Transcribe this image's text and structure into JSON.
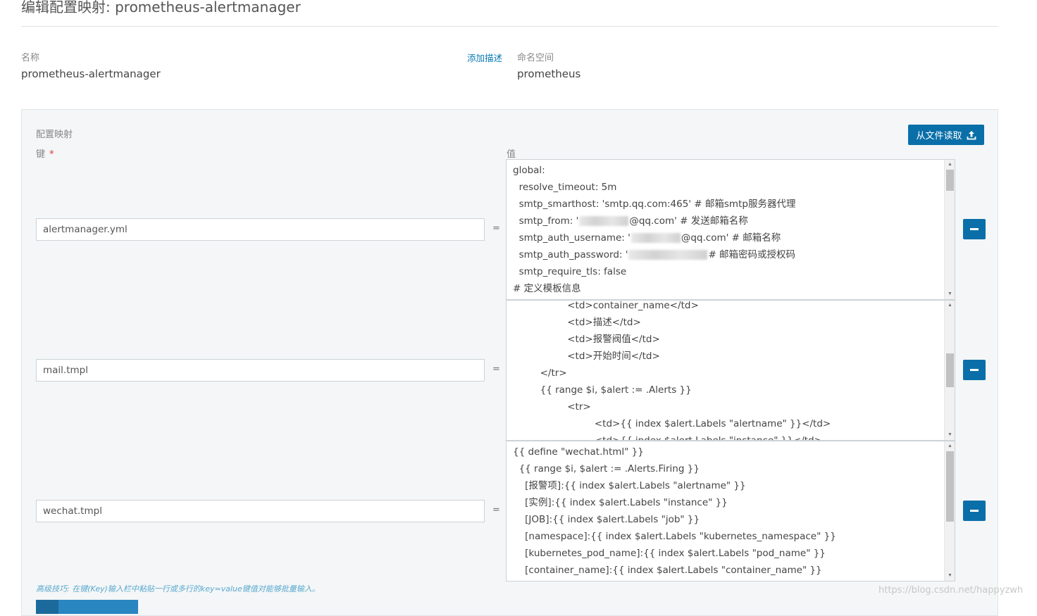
{
  "page": {
    "title": "编辑配置映射: prometheus-alertmanager"
  },
  "meta": {
    "name_label": "名称",
    "name_value": "prometheus-alertmanager",
    "add_description": "添加描述",
    "namespace_label": "命名空间",
    "namespace_value": "prometheus"
  },
  "config": {
    "section_title": "配置映射",
    "key_label": "键",
    "required_mark": "*",
    "value_label": "值",
    "upload_button": "从文件读取",
    "equals": "=",
    "entries": [
      {
        "key": "alertmanager.yml",
        "lines": [
          "global:",
          "  resolve_timeout: 5m",
          "  smtp_smarthost: 'smtp.qq.com:465' # 邮箱smtp服务器代理",
          [
            "  smtp_from: '",
            "@qq.com' # 发送邮箱名称"
          ],
          [
            "  smtp_auth_username: '",
            "@qq.com' # 邮箱名称"
          ],
          [
            "  smtp_auth_password: '",
            "# 邮箱密码或授权码"
          ],
          "  smtp_require_tls: false",
          "# 定义模板信息"
        ],
        "scroll": 0.0
      },
      {
        "key": "mail.tmpl",
        "lines": [
          "                  <td>container_name</td>",
          "                  <td>描述</td>",
          "                  <td>报警阀值</td>",
          "                  <td>开始时间</td>",
          "         </tr>",
          "         {{ range $i, $alert := .Alerts }}",
          "                  <tr>",
          "                           <td>{{ index $alert.Labels \"alertname\" }}</td>",
          "                           <td>{{ index $alert.Labels \"instance\" }}</td>"
        ],
        "scroll": 0.5
      },
      {
        "key": "wechat.tmpl",
        "lines": [
          "{{ define \"wechat.html\" }}",
          "  {{ range $i, $alert := .Alerts.Firing }}",
          "    [报警项]:{{ index $alert.Labels \"alertname\" }}",
          "    [实例]:{{ index $alert.Labels \"instance\" }}",
          "    [JOB]:{{ index $alert.Labels \"job\" }}",
          "    [namespace]:{{ index $alert.Labels \"kubernetes_namespace\" }}",
          "    [kubernetes_pod_name]:{{ index $alert.Labels \"pod_name\" }}",
          "    [container_name]:{{ index $alert.Labels \"container_name\" }}"
        ],
        "scroll": 0.0
      }
    ],
    "tip": "高级技巧: 在键(Key)输入栏中粘贴一行或多行的key=value键值对能够批量输入。"
  },
  "watermark": "https://blog.csdn.net/happyzwh",
  "colors": {
    "primary": "#0a6fa8",
    "link": "#0a7ab6",
    "required": "#dd3333"
  }
}
